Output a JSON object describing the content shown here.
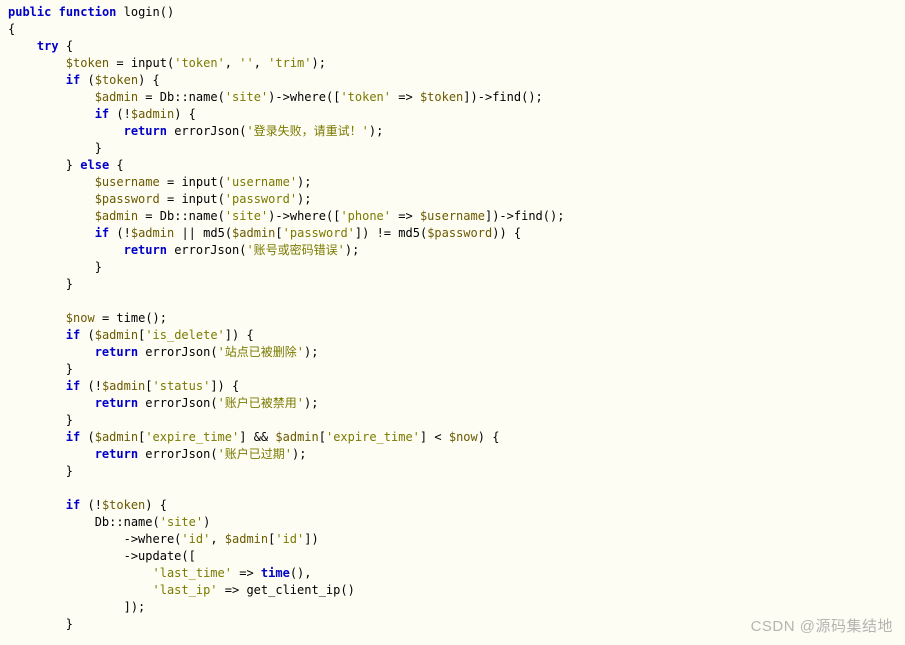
{
  "watermark": "CSDN @源码集结地",
  "code": {
    "lines": [
      {
        "indent": 0,
        "tokens": [
          {
            "t": "kw",
            "v": "public"
          },
          {
            "t": "sp",
            "v": " "
          },
          {
            "t": "kw",
            "v": "function"
          },
          {
            "t": "sp",
            "v": " "
          },
          {
            "t": "fn",
            "v": "login"
          },
          {
            "t": "pn",
            "v": "()"
          }
        ]
      },
      {
        "indent": 0,
        "tokens": [
          {
            "t": "pn",
            "v": "{"
          }
        ]
      },
      {
        "indent": 1,
        "tokens": [
          {
            "t": "kw",
            "v": "try"
          },
          {
            "t": "sp",
            "v": " "
          },
          {
            "t": "pn",
            "v": "{"
          }
        ]
      },
      {
        "indent": 2,
        "tokens": [
          {
            "t": "var",
            "v": "$token"
          },
          {
            "t": "sp",
            "v": " "
          },
          {
            "t": "pn",
            "v": "="
          },
          {
            "t": "sp",
            "v": " "
          },
          {
            "t": "fn",
            "v": "input"
          },
          {
            "t": "pn",
            "v": "("
          },
          {
            "t": "str",
            "v": "'token'"
          },
          {
            "t": "pn",
            "v": ", "
          },
          {
            "t": "str",
            "v": "''"
          },
          {
            "t": "pn",
            "v": ", "
          },
          {
            "t": "str",
            "v": "'trim'"
          },
          {
            "t": "pn",
            "v": ");"
          }
        ]
      },
      {
        "indent": 2,
        "tokens": [
          {
            "t": "kw",
            "v": "if"
          },
          {
            "t": "sp",
            "v": " "
          },
          {
            "t": "pn",
            "v": "("
          },
          {
            "t": "var",
            "v": "$token"
          },
          {
            "t": "pn",
            "v": ") {"
          }
        ]
      },
      {
        "indent": 3,
        "tokens": [
          {
            "t": "var",
            "v": "$admin"
          },
          {
            "t": "sp",
            "v": " "
          },
          {
            "t": "pn",
            "v": "="
          },
          {
            "t": "sp",
            "v": " "
          },
          {
            "t": "cls",
            "v": "Db"
          },
          {
            "t": "op",
            "v": "::"
          },
          {
            "t": "fn",
            "v": "name"
          },
          {
            "t": "pn",
            "v": "("
          },
          {
            "t": "str",
            "v": "'site'"
          },
          {
            "t": "pn",
            "v": ")->"
          },
          {
            "t": "fn",
            "v": "where"
          },
          {
            "t": "pn",
            "v": "(["
          },
          {
            "t": "str",
            "v": "'token'"
          },
          {
            "t": "sp",
            "v": " "
          },
          {
            "t": "pn",
            "v": "=>"
          },
          {
            "t": "sp",
            "v": " "
          },
          {
            "t": "var",
            "v": "$token"
          },
          {
            "t": "pn",
            "v": "])->"
          },
          {
            "t": "fn",
            "v": "find"
          },
          {
            "t": "pn",
            "v": "();"
          }
        ]
      },
      {
        "indent": 3,
        "tokens": [
          {
            "t": "kw",
            "v": "if"
          },
          {
            "t": "sp",
            "v": " "
          },
          {
            "t": "pn",
            "v": "(!"
          },
          {
            "t": "var",
            "v": "$admin"
          },
          {
            "t": "pn",
            "v": ") {"
          }
        ]
      },
      {
        "indent": 4,
        "tokens": [
          {
            "t": "kw",
            "v": "return"
          },
          {
            "t": "sp",
            "v": " "
          },
          {
            "t": "fn",
            "v": "errorJson"
          },
          {
            "t": "pn",
            "v": "("
          },
          {
            "t": "str",
            "v": "'登录失败，请重试！'"
          },
          {
            "t": "pn",
            "v": ");"
          }
        ]
      },
      {
        "indent": 3,
        "tokens": [
          {
            "t": "pn",
            "v": "}"
          }
        ]
      },
      {
        "indent": 2,
        "tokens": [
          {
            "t": "pn",
            "v": "}"
          },
          {
            "t": "sp",
            "v": " "
          },
          {
            "t": "kw",
            "v": "else"
          },
          {
            "t": "sp",
            "v": " "
          },
          {
            "t": "pn",
            "v": "{"
          }
        ]
      },
      {
        "indent": 3,
        "tokens": [
          {
            "t": "var",
            "v": "$username"
          },
          {
            "t": "sp",
            "v": " "
          },
          {
            "t": "pn",
            "v": "="
          },
          {
            "t": "sp",
            "v": " "
          },
          {
            "t": "fn",
            "v": "input"
          },
          {
            "t": "pn",
            "v": "("
          },
          {
            "t": "str",
            "v": "'username'"
          },
          {
            "t": "pn",
            "v": ");"
          }
        ]
      },
      {
        "indent": 3,
        "tokens": [
          {
            "t": "var",
            "v": "$password"
          },
          {
            "t": "sp",
            "v": " "
          },
          {
            "t": "pn",
            "v": "="
          },
          {
            "t": "sp",
            "v": " "
          },
          {
            "t": "fn",
            "v": "input"
          },
          {
            "t": "pn",
            "v": "("
          },
          {
            "t": "str",
            "v": "'password'"
          },
          {
            "t": "pn",
            "v": ");"
          }
        ]
      },
      {
        "indent": 3,
        "tokens": [
          {
            "t": "var",
            "v": "$admin"
          },
          {
            "t": "sp",
            "v": " "
          },
          {
            "t": "pn",
            "v": "="
          },
          {
            "t": "sp",
            "v": " "
          },
          {
            "t": "cls",
            "v": "Db"
          },
          {
            "t": "op",
            "v": "::"
          },
          {
            "t": "fn",
            "v": "name"
          },
          {
            "t": "pn",
            "v": "("
          },
          {
            "t": "str",
            "v": "'site'"
          },
          {
            "t": "pn",
            "v": ")->"
          },
          {
            "t": "fn",
            "v": "where"
          },
          {
            "t": "pn",
            "v": "(["
          },
          {
            "t": "str",
            "v": "'phone'"
          },
          {
            "t": "sp",
            "v": " "
          },
          {
            "t": "pn",
            "v": "=>"
          },
          {
            "t": "sp",
            "v": " "
          },
          {
            "t": "var",
            "v": "$username"
          },
          {
            "t": "pn",
            "v": "])->"
          },
          {
            "t": "fn",
            "v": "find"
          },
          {
            "t": "pn",
            "v": "();"
          }
        ]
      },
      {
        "indent": 3,
        "tokens": [
          {
            "t": "kw",
            "v": "if"
          },
          {
            "t": "sp",
            "v": " "
          },
          {
            "t": "pn",
            "v": "(!"
          },
          {
            "t": "var",
            "v": "$admin"
          },
          {
            "t": "sp",
            "v": " "
          },
          {
            "t": "pn",
            "v": "||"
          },
          {
            "t": "sp",
            "v": " "
          },
          {
            "t": "fn",
            "v": "md5"
          },
          {
            "t": "pn",
            "v": "("
          },
          {
            "t": "var",
            "v": "$admin"
          },
          {
            "t": "pn",
            "v": "["
          },
          {
            "t": "str",
            "v": "'password'"
          },
          {
            "t": "pn",
            "v": "])"
          },
          {
            "t": "sp",
            "v": " "
          },
          {
            "t": "pn",
            "v": "!="
          },
          {
            "t": "sp",
            "v": " "
          },
          {
            "t": "fn",
            "v": "md5"
          },
          {
            "t": "pn",
            "v": "("
          },
          {
            "t": "var",
            "v": "$password"
          },
          {
            "t": "pn",
            "v": ")) {"
          }
        ]
      },
      {
        "indent": 4,
        "tokens": [
          {
            "t": "kw",
            "v": "return"
          },
          {
            "t": "sp",
            "v": " "
          },
          {
            "t": "fn",
            "v": "errorJson"
          },
          {
            "t": "pn",
            "v": "("
          },
          {
            "t": "str",
            "v": "'账号或密码错误'"
          },
          {
            "t": "pn",
            "v": ");"
          }
        ]
      },
      {
        "indent": 3,
        "tokens": [
          {
            "t": "pn",
            "v": "}"
          }
        ]
      },
      {
        "indent": 2,
        "tokens": [
          {
            "t": "pn",
            "v": "}"
          }
        ]
      },
      {
        "indent": 0,
        "tokens": [
          {
            "t": "sp",
            "v": ""
          }
        ]
      },
      {
        "indent": 2,
        "tokens": [
          {
            "t": "var",
            "v": "$now"
          },
          {
            "t": "sp",
            "v": " "
          },
          {
            "t": "pn",
            "v": "="
          },
          {
            "t": "sp",
            "v": " "
          },
          {
            "t": "fn",
            "v": "time"
          },
          {
            "t": "pn",
            "v": "();"
          }
        ]
      },
      {
        "indent": 2,
        "tokens": [
          {
            "t": "kw",
            "v": "if"
          },
          {
            "t": "sp",
            "v": " "
          },
          {
            "t": "pn",
            "v": "("
          },
          {
            "t": "var",
            "v": "$admin"
          },
          {
            "t": "pn",
            "v": "["
          },
          {
            "t": "str",
            "v": "'is_delete'"
          },
          {
            "t": "pn",
            "v": "]) {"
          }
        ]
      },
      {
        "indent": 3,
        "tokens": [
          {
            "t": "kw",
            "v": "return"
          },
          {
            "t": "sp",
            "v": " "
          },
          {
            "t": "fn",
            "v": "errorJson"
          },
          {
            "t": "pn",
            "v": "("
          },
          {
            "t": "str",
            "v": "'站点已被删除'"
          },
          {
            "t": "pn",
            "v": ");"
          }
        ]
      },
      {
        "indent": 2,
        "tokens": [
          {
            "t": "pn",
            "v": "}"
          }
        ]
      },
      {
        "indent": 2,
        "tokens": [
          {
            "t": "kw",
            "v": "if"
          },
          {
            "t": "sp",
            "v": " "
          },
          {
            "t": "pn",
            "v": "(!"
          },
          {
            "t": "var",
            "v": "$admin"
          },
          {
            "t": "pn",
            "v": "["
          },
          {
            "t": "str",
            "v": "'status'"
          },
          {
            "t": "pn",
            "v": "]) {"
          }
        ]
      },
      {
        "indent": 3,
        "tokens": [
          {
            "t": "kw",
            "v": "return"
          },
          {
            "t": "sp",
            "v": " "
          },
          {
            "t": "fn",
            "v": "errorJson"
          },
          {
            "t": "pn",
            "v": "("
          },
          {
            "t": "str",
            "v": "'账户已被禁用'"
          },
          {
            "t": "pn",
            "v": ");"
          }
        ]
      },
      {
        "indent": 2,
        "tokens": [
          {
            "t": "pn",
            "v": "}"
          }
        ]
      },
      {
        "indent": 2,
        "tokens": [
          {
            "t": "kw",
            "v": "if"
          },
          {
            "t": "sp",
            "v": " "
          },
          {
            "t": "pn",
            "v": "("
          },
          {
            "t": "var",
            "v": "$admin"
          },
          {
            "t": "pn",
            "v": "["
          },
          {
            "t": "str",
            "v": "'expire_time'"
          },
          {
            "t": "pn",
            "v": "]"
          },
          {
            "t": "sp",
            "v": " "
          },
          {
            "t": "pn",
            "v": "&&"
          },
          {
            "t": "sp",
            "v": " "
          },
          {
            "t": "var",
            "v": "$admin"
          },
          {
            "t": "pn",
            "v": "["
          },
          {
            "t": "str",
            "v": "'expire_time'"
          },
          {
            "t": "pn",
            "v": "]"
          },
          {
            "t": "sp",
            "v": " "
          },
          {
            "t": "pn",
            "v": "<"
          },
          {
            "t": "sp",
            "v": " "
          },
          {
            "t": "var",
            "v": "$now"
          },
          {
            "t": "pn",
            "v": ") {"
          }
        ]
      },
      {
        "indent": 3,
        "tokens": [
          {
            "t": "kw",
            "v": "return"
          },
          {
            "t": "sp",
            "v": " "
          },
          {
            "t": "fn",
            "v": "errorJson"
          },
          {
            "t": "pn",
            "v": "("
          },
          {
            "t": "str",
            "v": "'账户已过期'"
          },
          {
            "t": "pn",
            "v": ");"
          }
        ]
      },
      {
        "indent": 2,
        "tokens": [
          {
            "t": "pn",
            "v": "}"
          }
        ]
      },
      {
        "indent": 0,
        "tokens": [
          {
            "t": "sp",
            "v": ""
          }
        ]
      },
      {
        "indent": 2,
        "tokens": [
          {
            "t": "kw",
            "v": "if"
          },
          {
            "t": "sp",
            "v": " "
          },
          {
            "t": "pn",
            "v": "(!"
          },
          {
            "t": "var",
            "v": "$token"
          },
          {
            "t": "pn",
            "v": ") {"
          }
        ]
      },
      {
        "indent": 3,
        "tokens": [
          {
            "t": "cls",
            "v": "Db"
          },
          {
            "t": "op",
            "v": "::"
          },
          {
            "t": "fn",
            "v": "name"
          },
          {
            "t": "pn",
            "v": "("
          },
          {
            "t": "str",
            "v": "'site'"
          },
          {
            "t": "pn",
            "v": ")"
          }
        ]
      },
      {
        "indent": 4,
        "tokens": [
          {
            "t": "pn",
            "v": "->"
          },
          {
            "t": "fn",
            "v": "where"
          },
          {
            "t": "pn",
            "v": "("
          },
          {
            "t": "str",
            "v": "'id'"
          },
          {
            "t": "pn",
            "v": ", "
          },
          {
            "t": "var",
            "v": "$admin"
          },
          {
            "t": "pn",
            "v": "["
          },
          {
            "t": "str",
            "v": "'id'"
          },
          {
            "t": "pn",
            "v": "])"
          }
        ]
      },
      {
        "indent": 4,
        "tokens": [
          {
            "t": "pn",
            "v": "->"
          },
          {
            "t": "fn",
            "v": "update"
          },
          {
            "t": "pn",
            "v": "(["
          }
        ]
      },
      {
        "indent": 5,
        "tokens": [
          {
            "t": "str",
            "v": "'last_time'"
          },
          {
            "t": "sp",
            "v": " "
          },
          {
            "t": "pn",
            "v": "=>"
          },
          {
            "t": "sp",
            "v": " "
          },
          {
            "t": "kw",
            "v": "time"
          },
          {
            "t": "pn",
            "v": "(),"
          }
        ]
      },
      {
        "indent": 5,
        "tokens": [
          {
            "t": "str",
            "v": "'last_ip'"
          },
          {
            "t": "sp",
            "v": " "
          },
          {
            "t": "pn",
            "v": "=>"
          },
          {
            "t": "sp",
            "v": " "
          },
          {
            "t": "fn",
            "v": "get_client_ip"
          },
          {
            "t": "pn",
            "v": "()"
          }
        ]
      },
      {
        "indent": 4,
        "tokens": [
          {
            "t": "pn",
            "v": "]);"
          }
        ]
      },
      {
        "indent": 2,
        "tokens": [
          {
            "t": "pn",
            "v": "}"
          }
        ]
      }
    ]
  }
}
